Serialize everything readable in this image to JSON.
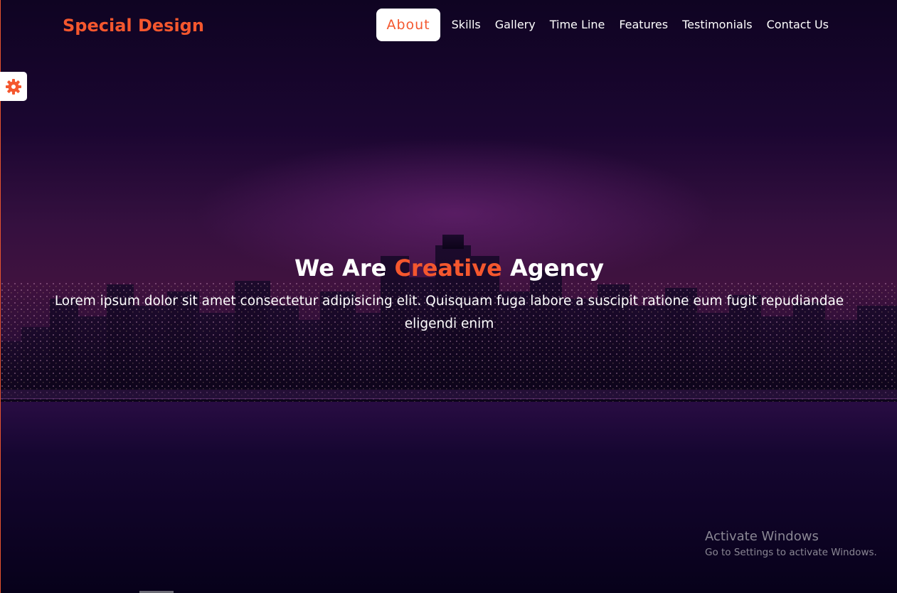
{
  "brand": {
    "name": "Special Design",
    "color": "#f4572e"
  },
  "nav": {
    "items": [
      {
        "label": "About",
        "active": true
      },
      {
        "label": "Skills",
        "active": false
      },
      {
        "label": "Gallery",
        "active": false
      },
      {
        "label": "Time Line",
        "active": false
      },
      {
        "label": "Features",
        "active": false
      },
      {
        "label": "Testimonials",
        "active": false
      },
      {
        "label": "Contact Us",
        "active": false
      }
    ]
  },
  "settings": {
    "icon": "gear-icon",
    "color": "#f4572e"
  },
  "hero": {
    "title_before": "We Are ",
    "title_accent": "Creative",
    "title_after": " Agency",
    "text": "Lorem ipsum dolor sit amet consectetur adipisicing elit. Quisquam fuga labore a suscipit ratione eum fugit repudiandae eligendi enim"
  },
  "watermark": {
    "title": "Activate Windows",
    "subtitle": "Go to Settings to activate Windows."
  },
  "colors": {
    "accent": "#f4572e",
    "text": "#ffffff",
    "background": "#0a0220"
  }
}
